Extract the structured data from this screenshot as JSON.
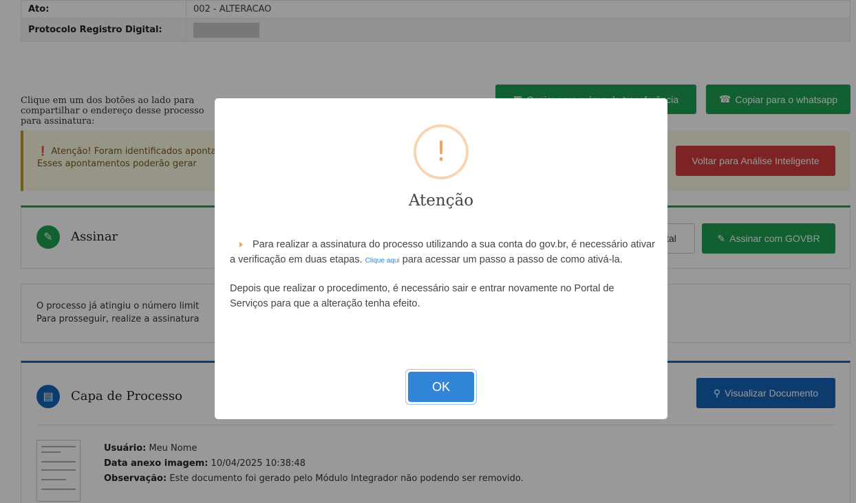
{
  "record": {
    "rows": [
      {
        "label": "Ato:",
        "value": "002 - ALTERACAO"
      },
      {
        "label": "Protocolo Registro Digital:",
        "value": ""
      }
    ]
  },
  "share": {
    "text": "Clique em um dos botões ao lado para compartilhar o endereço desse processo para assinatura:",
    "copy_clipboard_label": "Copiar para a área de transferência",
    "copy_whatsapp_label": "Copiar para o whatsapp"
  },
  "alert": {
    "line1": "Atenção! Foram identificados apontamentos",
    "line2": "Esses apontamentos poderão gerar",
    "back_button_label": "Voltar para Análise Inteligente"
  },
  "assinar_panel": {
    "title": "Assinar",
    "digital_button_label": "gital",
    "govbr_button_label": "Assinar com GOVBR"
  },
  "limit_panel": {
    "line1": "O processo já atingiu o número limit",
    "line2": "Para prosseguir, realize a assinatura"
  },
  "capa_panel": {
    "title": "Capa de Processo",
    "view_button_label": "Visualizar Documento",
    "usuario_label": "Usuário:",
    "usuario_value": "Meu Nome",
    "data_label": "Data anexo imagem:",
    "data_value": "10/04/2025 10:38:48",
    "obs_label": "Observação:",
    "obs_value": "Este documento foi gerado pelo Módulo Integrador não podendo ser removido."
  },
  "modal": {
    "icon_symbol": "!",
    "title": "Atenção",
    "p1_before_link": "Para realizar a assinatura do processo utilizando a sua conta do gov.br, é necessário ativar a verificação em duas etapas.",
    "link_text": "Clique aqui",
    "p1_after_link": "para acessar um passo a passo de como ativá-la.",
    "p2": "Depois que realizar o procedimento, é necessário sair e entrar novamente no Portal de Serviços para que a alteração tenha efeito.",
    "ok_label": "OK"
  },
  "colors": {
    "primary_green": "#1e9e52",
    "danger_red": "#d13b3b",
    "primary_blue": "#1565b8",
    "modal_button": "#3085d6",
    "warning_orange": "#f0a45f"
  },
  "icons": {
    "clipboard": "clipboard-icon",
    "whatsapp": "whatsapp-icon",
    "info": "info-circle-icon",
    "edit": "edit-icon",
    "document": "document-icon",
    "search": "search-icon",
    "warning": "warning-icon"
  }
}
